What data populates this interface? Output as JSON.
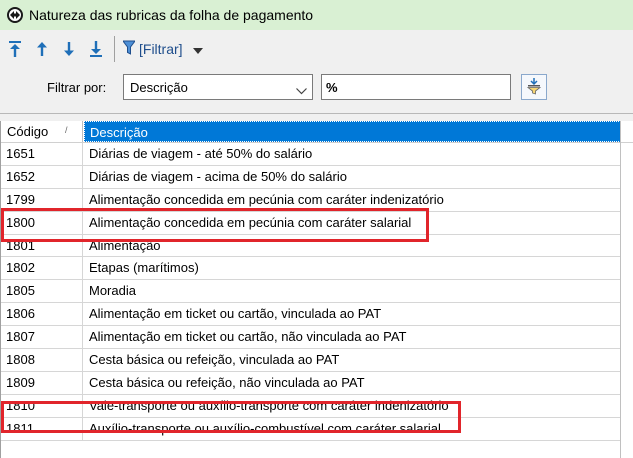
{
  "window": {
    "title": "Natureza das rubricas da folha de pagamento"
  },
  "toolbar": {
    "buttons": [
      "move-first-icon",
      "move-up-icon",
      "move-down-icon",
      "move-last-icon"
    ],
    "filter_label": "[Filtrar]"
  },
  "filter": {
    "label": "Filtrar por:",
    "field_value": "Descrição",
    "text_value": "%"
  },
  "grid": {
    "columns": [
      "Código",
      "Descrição"
    ],
    "selected_column": "Descrição",
    "rows": [
      {
        "code": "1651",
        "desc": "Diárias de viagem - até 50% do salário"
      },
      {
        "code": "1652",
        "desc": "Diárias de viagem - acima de 50% do salário"
      },
      {
        "code": "1799",
        "desc": "Alimentação concedida em pecúnia com caráter indenizatório"
      },
      {
        "code": "1800",
        "desc": "Alimentação concedida em pecúnia com caráter salarial"
      },
      {
        "code": "1801",
        "desc": "Alimentação"
      },
      {
        "code": "1802",
        "desc": "Etapas (marítimos)"
      },
      {
        "code": "1805",
        "desc": "Moradia"
      },
      {
        "code": "1806",
        "desc": "Alimentação em ticket ou cartão, vinculada ao PAT"
      },
      {
        "code": "1807",
        "desc": "Alimentação em ticket ou cartão, não vinculada ao PAT"
      },
      {
        "code": "1808",
        "desc": "Cesta básica ou refeição, vinculada ao PAT"
      },
      {
        "code": "1809",
        "desc": "Cesta básica ou refeição, não vinculada ao PAT"
      },
      {
        "code": "1810",
        "desc": "Vale-transporte ou auxílio-transporte com caráter indenizatório"
      },
      {
        "code": "1811",
        "desc": "Auxílio-transporte ou auxílio-combustível com caráter salarial"
      }
    ],
    "highlighted_codes": [
      "1800",
      "1810"
    ]
  },
  "colors": {
    "titlebar": "#d9f0d3",
    "header_selected": "#0078d7",
    "highlight": "#e1252b",
    "toolbar_icon": "#1f6fb8"
  }
}
